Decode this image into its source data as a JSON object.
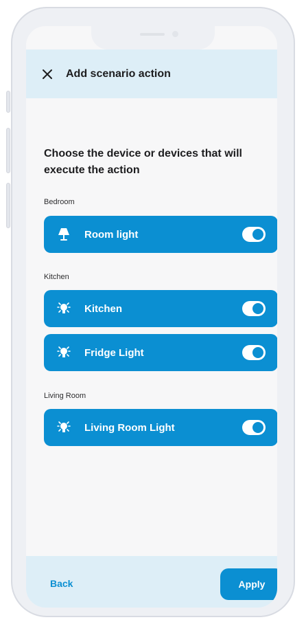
{
  "header": {
    "title": "Add scenario action",
    "close_icon": "close-icon"
  },
  "prompt": "Choose the device or devices that will execute the action",
  "groups": [
    {
      "label": "Bedroom",
      "devices": [
        {
          "label": "Room light",
          "icon": "lamp-icon",
          "enabled": true
        }
      ]
    },
    {
      "label": "Kitchen",
      "devices": [
        {
          "label": "Kitchen",
          "icon": "lightbulb-icon",
          "enabled": true
        },
        {
          "label": "Fridge Light",
          "icon": "lightbulb-icon",
          "enabled": true
        }
      ]
    },
    {
      "label": "Living Room",
      "devices": [
        {
          "label": "Living Room Light",
          "icon": "lightbulb-icon",
          "enabled": true
        }
      ]
    }
  ],
  "footer": {
    "back_label": "Back",
    "apply_label": "Apply"
  },
  "colors": {
    "accent": "#0b8fd2",
    "header_bg": "#ddeef7",
    "screen_bg": "#f7f7f8"
  }
}
